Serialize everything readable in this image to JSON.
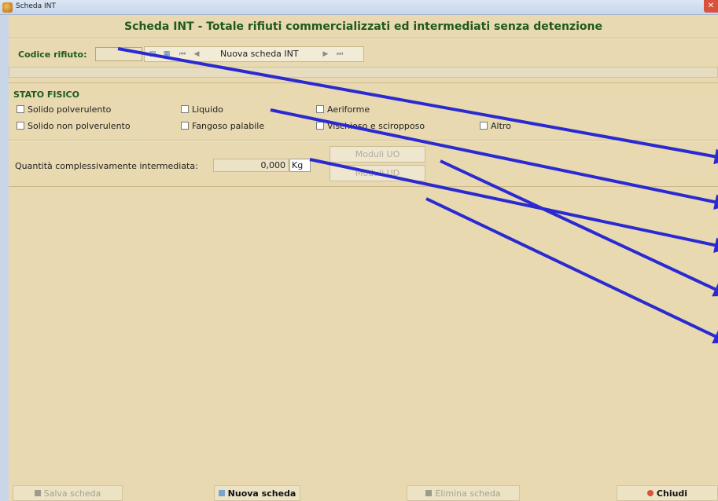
{
  "window": {
    "title": "Scheda INT",
    "close_glyph": "✕"
  },
  "header": {
    "title": "Scheda INT - Totale rifiuti commercializzati ed intermediati senza detenzione"
  },
  "codice": {
    "label": "Codice rifiuto:",
    "value": ""
  },
  "navigator": {
    "label": "Nuova scheda INT",
    "first": "⏮",
    "prev": "◀",
    "next": "▶",
    "last": "⏭"
  },
  "stato_fisico": {
    "title": "STATO FISICO",
    "options": [
      "Solido polverulento",
      "Liquido",
      "Aeriforme",
      "Solido non polverulento",
      "Fangoso palabile",
      "Vischioso e sciropposo",
      "Altro"
    ]
  },
  "quantita": {
    "label": "Quantità complessivamente intermediata:",
    "value": "0,000",
    "unit": "Kg"
  },
  "moduli": {
    "uo": "Moduli UO",
    "ud": "Moduli UD"
  },
  "footer": {
    "salva": "Salva scheda",
    "nuova": "Nuova scheda",
    "elimina": "Elimina scheda",
    "chiudi": "Chiudi"
  },
  "colors": {
    "background": "#e8d9b0",
    "accent_green": "#1e5a1e",
    "annotation_arrow": "#2a2ad0"
  }
}
